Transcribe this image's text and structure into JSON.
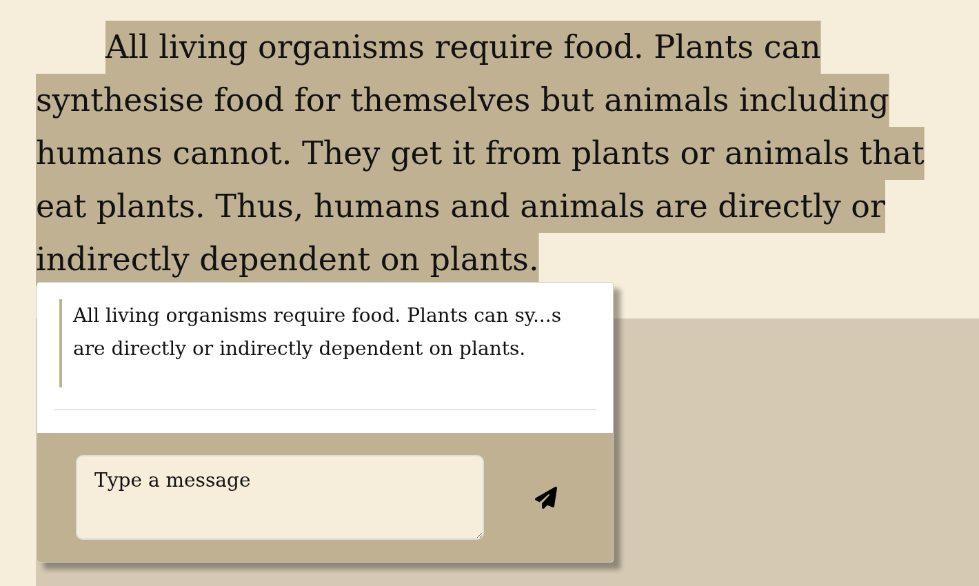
{
  "passage": {
    "text": "All living organisms require food. Plants can synthesise food for themselves but animals including humans cannot. They get it from plants or animals that eat plants. Thus, humans and animals are directly or indirectly dependent on plants.",
    "highlighted": true
  },
  "comment_popup": {
    "quote": "All living organisms require food. Plants can sy...s are directly or indirectly dependent on plants.",
    "message_field": {
      "placeholder": "Type a message"
    }
  }
}
